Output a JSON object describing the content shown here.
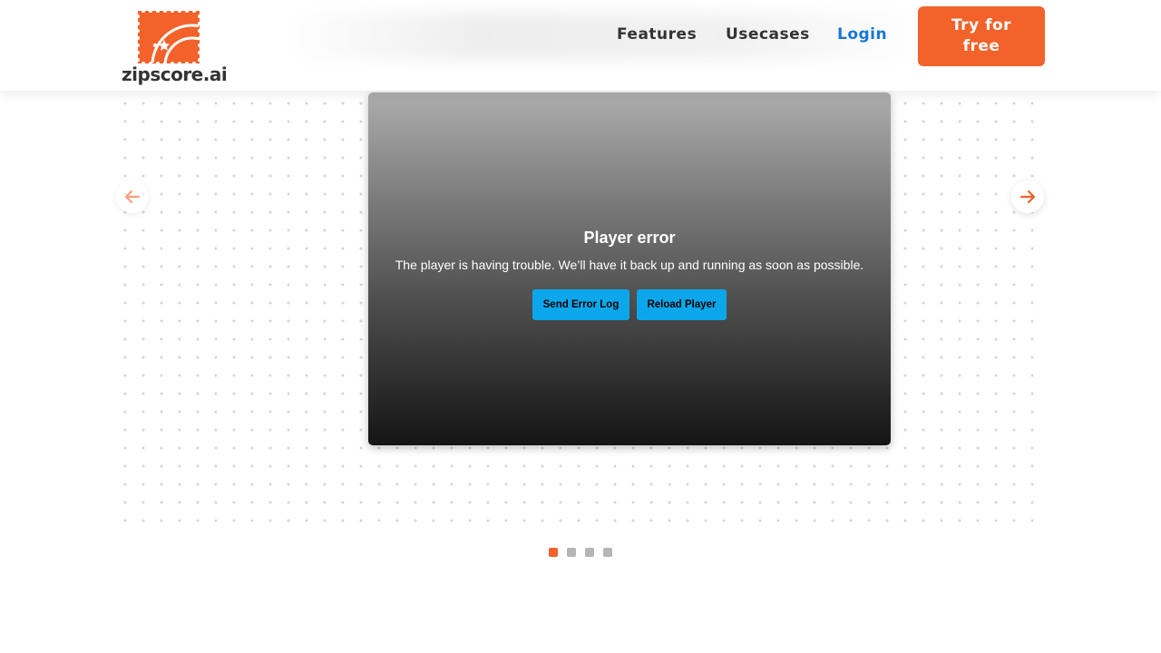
{
  "brand": {
    "name": "zipscore.ai",
    "accent_color": "#f2622a"
  },
  "nav": {
    "features_label": "Features",
    "usecases_label": "Usecases",
    "login_label": "Login",
    "login_color": "#1877d6",
    "cta_label": "Try for free"
  },
  "carousel": {
    "prev_icon": "arrow-left-icon",
    "next_icon": "arrow-right-icon",
    "total_slides": 4,
    "active_slide": 1
  },
  "player": {
    "error_title": "Player error",
    "error_message": "The player is having trouble. We’ll have it back up and running as soon as possible.",
    "send_log_label": "Send Error Log",
    "reload_label": "Reload Player",
    "button_color": "#0ba7ea"
  }
}
